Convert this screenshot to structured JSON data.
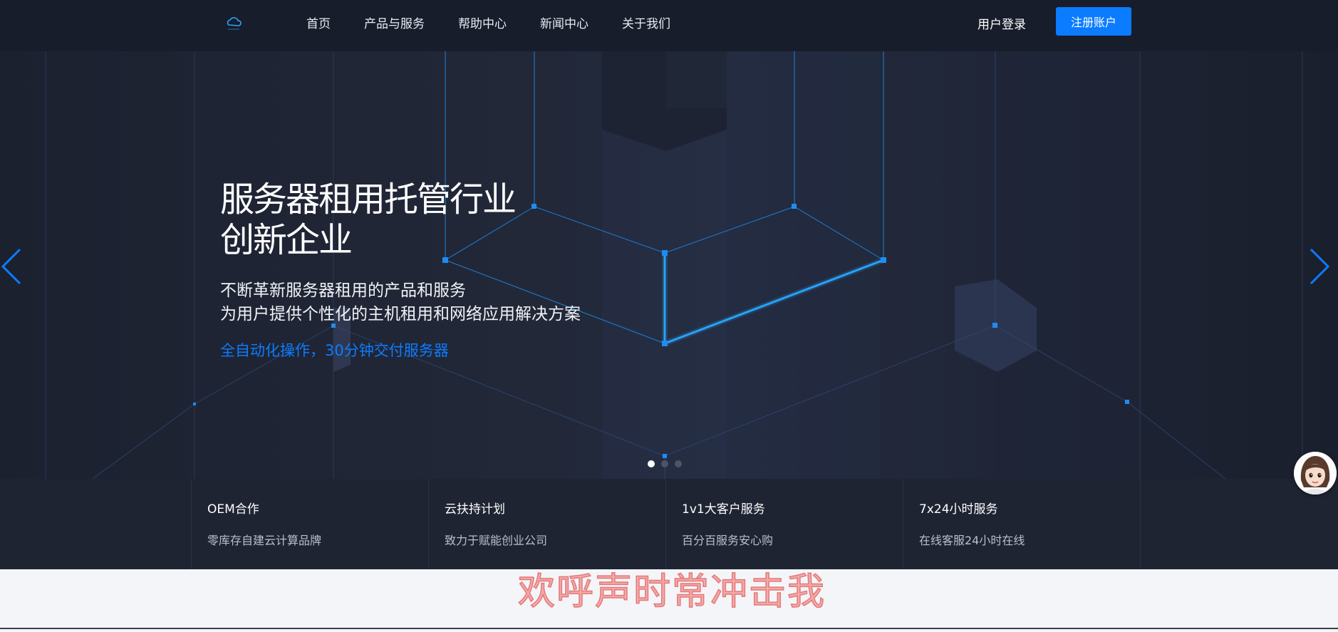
{
  "nav": {
    "logo_icon": "cloud-icon",
    "items": [
      "首页",
      "产品与服务",
      "帮助中心",
      "新闻中心",
      "关于我们"
    ],
    "login_label": "用户登录",
    "register_label": "注册账户"
  },
  "hero": {
    "title_line1": "服务器租用托管行业",
    "title_line2": "创新企业",
    "subtitle_line1": "不断革新服务器租用的产品和服务",
    "subtitle_line2": "为用户提供个性化的主机租用和网络应用解决方案",
    "accent_text": "全自动化操作，30分钟交付服务器",
    "slides_total": 3,
    "active_slide": 1
  },
  "features": [
    {
      "title": "OEM合作",
      "desc": "零库存自建云计算品牌"
    },
    {
      "title": "云扶持计划",
      "desc": "致力于赋能创业公司"
    },
    {
      "title": "1v1大客户服务",
      "desc": "百分百服务安心购"
    },
    {
      "title": "7x24小时服务",
      "desc": "在线客服24小时在线"
    }
  ],
  "overlay_text": "欢呼声时常冲击我",
  "colors": {
    "accent": "#0b7cff",
    "nav_bg": "#171d2b",
    "hero_bg": "#1f2433",
    "overlay_text": "#f6a9a9"
  }
}
